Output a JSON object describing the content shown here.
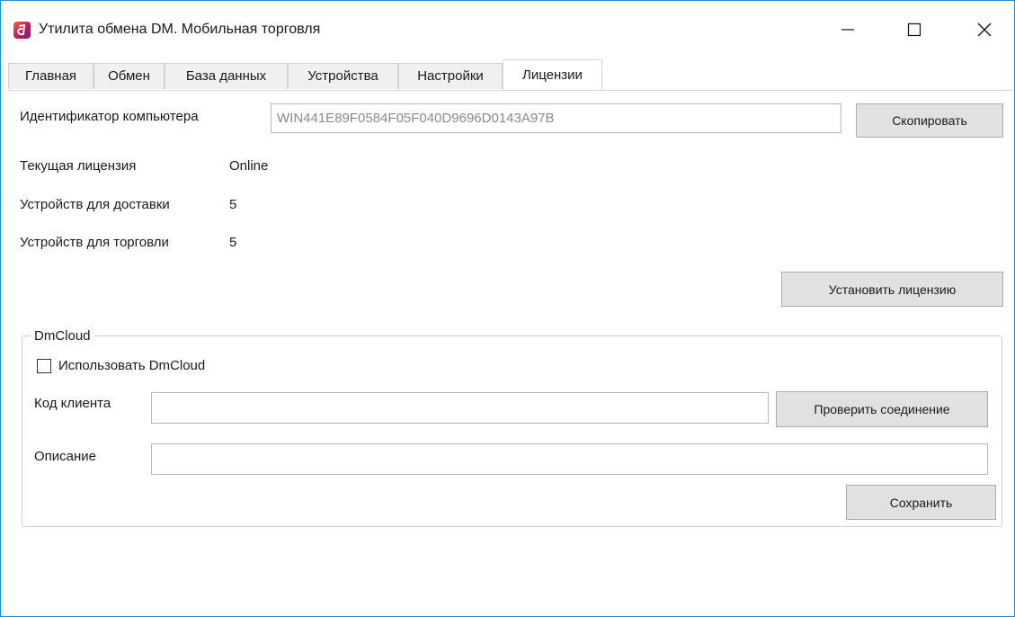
{
  "window": {
    "title": "Утилита обмена DM. Мобильная торговля",
    "controls": {
      "minimize": "minimize",
      "maximize": "maximize",
      "close": "close"
    }
  },
  "tabs": [
    {
      "label": "Главная",
      "active": false
    },
    {
      "label": "Обмен",
      "active": false
    },
    {
      "label": "База данных",
      "active": false
    },
    {
      "label": "Устройства",
      "active": false
    },
    {
      "label": "Настройки",
      "active": false
    },
    {
      "label": "Лицензии",
      "active": true
    }
  ],
  "license": {
    "computer_id_label": "Идентификатор компьютера",
    "computer_id_value": "WIN441E89F0584F05F040D9696D0143A97B",
    "copy_button": "Скопировать",
    "current_license_label": "Текущая лицензия",
    "current_license_value": "Online",
    "delivery_devices_label": "Устройств для доставки",
    "delivery_devices_value": "5",
    "trade_devices_label": "Устройств для торговли",
    "trade_devices_value": "5",
    "install_button": "Установить лицензию"
  },
  "dmcloud": {
    "group_title": "DmCloud",
    "use_checkbox_label": "Использовать DmCloud",
    "use_checked": false,
    "client_code_label": "Код клиента",
    "client_code_value": "",
    "check_connection_button": "Проверить соединение",
    "description_label": "Описание",
    "description_value": "",
    "save_button": "Сохранить"
  },
  "colors": {
    "window_border": "#1c8fd9",
    "button_bg": "#e1e1e1",
    "tab_bg": "#f0f0f0"
  }
}
